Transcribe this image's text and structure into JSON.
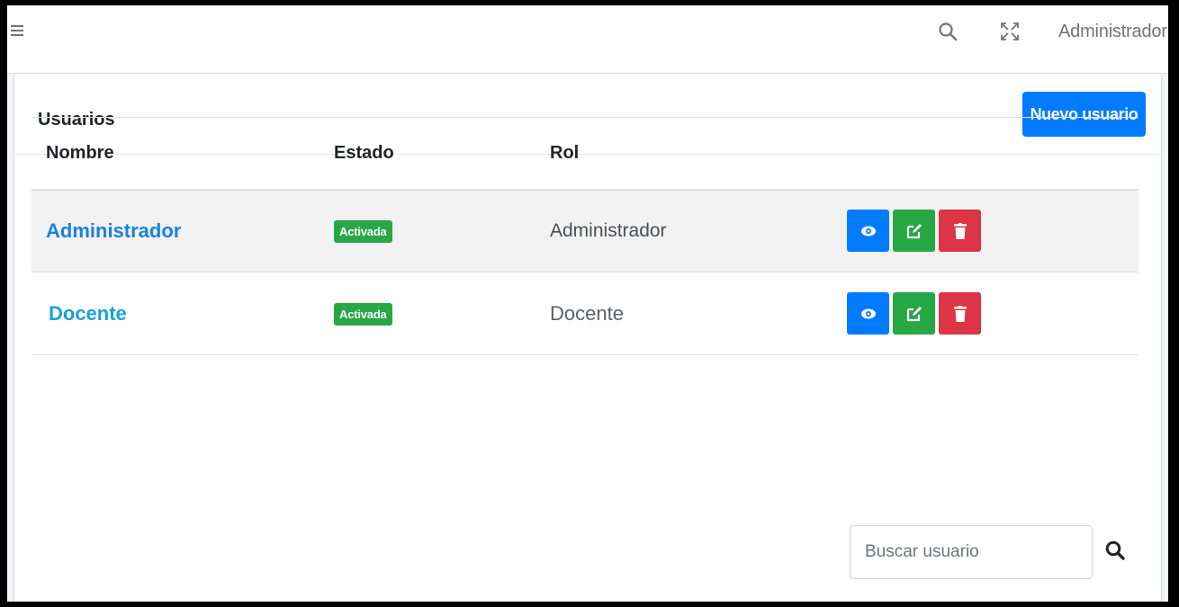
{
  "navbar": {
    "menu_icon": "hamburger-icon",
    "search_icon": "search-icon",
    "expand_icon": "fullscreen-icon",
    "user_name": "Administrador"
  },
  "card": {
    "title": "Usuarios",
    "new_button": "Nuevo usuario"
  },
  "table": {
    "headers": {
      "name": "Nombre",
      "state": "Estado",
      "role": "Rol"
    },
    "rows": [
      {
        "name": "Administrador",
        "state": "Activada",
        "role": "Administrador"
      },
      {
        "name": "Docente",
        "state": "Activada",
        "role": "Docente"
      }
    ],
    "actions": [
      "eye-icon",
      "edit-icon",
      "trash-icon"
    ]
  },
  "search": {
    "placeholder": "Buscar usuario"
  },
  "colors": {
    "primary": "#007bff",
    "success": "#28a745",
    "danger": "#dc3545",
    "link": "#1c80e0"
  }
}
